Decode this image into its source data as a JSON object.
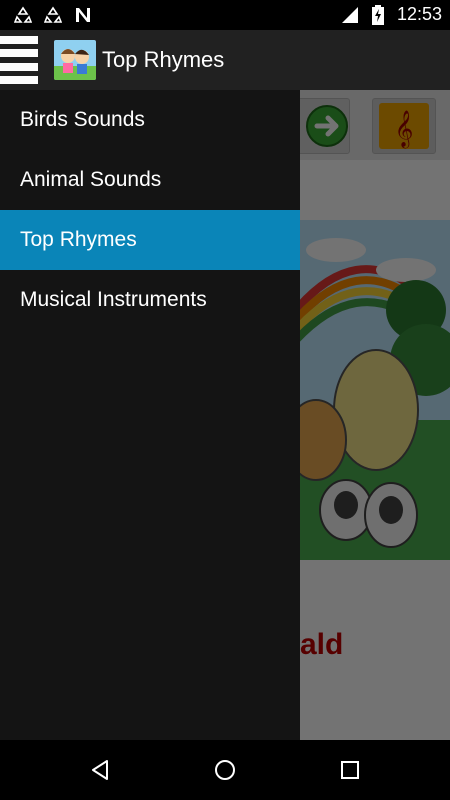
{
  "status_bar": {
    "time": "12:53",
    "left_icons": [
      "recycle-icon",
      "recycle-icon",
      "n-notification-icon"
    ],
    "right_icons": [
      "wifi-icon",
      "battery-charging-icon"
    ]
  },
  "app_bar": {
    "title": "Top Rhymes",
    "menu_icon": "hamburger-menu-icon"
  },
  "drawer": {
    "items": [
      {
        "label": "Birds Sounds",
        "active": false
      },
      {
        "label": "Animal Sounds",
        "active": false
      },
      {
        "label": "Top Rhymes",
        "active": true
      },
      {
        "label": "Musical Instruments",
        "active": false
      }
    ],
    "active_color": "#0a85b8"
  },
  "background_content": {
    "partial_text": "ald"
  },
  "nav_bar": {
    "buttons": [
      "back-icon",
      "home-icon",
      "recents-icon"
    ]
  }
}
